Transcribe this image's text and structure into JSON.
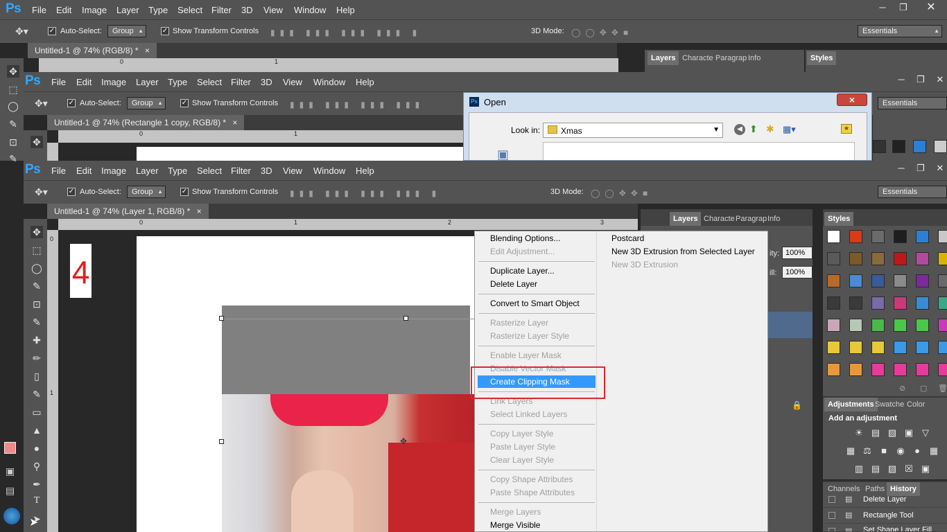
{
  "app": {
    "logo": "Ps",
    "menu": [
      "File",
      "Edit",
      "Image",
      "Layer",
      "Type",
      "Select",
      "Filter",
      "3D",
      "View",
      "Window",
      "Help"
    ],
    "window_buttons": [
      "minimize-icon",
      "restore-icon",
      "close-icon"
    ]
  },
  "options": {
    "auto_select_label": "Auto-Select:",
    "auto_select_value": "Group",
    "show_transform_label": "Show Transform Controls",
    "mode_3d_label": "3D Mode:",
    "workspace": "Essentials"
  },
  "windows": {
    "top": {
      "tab": "Untitled-1 @ 74% (RGB/8) *",
      "tab_close": "×"
    },
    "middle": {
      "tab": "Untitled-1 @ 74% (Rectangle 1 copy, RGB/8) *",
      "tab_close": "×"
    },
    "front": {
      "tab": "Untitled-1 @ 74% (Layer 1, RGB/8) *",
      "tab_close": "×"
    }
  },
  "rulers": {
    "top_marks": [
      "0",
      "1"
    ],
    "middle_marks": [
      "0",
      "1"
    ],
    "front_marks": [
      "0",
      "1",
      "2",
      "3"
    ],
    "left_marks": [
      "0",
      "1"
    ]
  },
  "top_panel_tabs": [
    "Layers",
    "Characte",
    "Paragrap",
    "Info"
  ],
  "top_styles_tab": "Styles",
  "open_dialog": {
    "title": "Open",
    "look_in_label": "Look in:",
    "folder": "Xmas",
    "close": "×"
  },
  "canvas": {
    "step_number": "4"
  },
  "context_menu": {
    "left": [
      {
        "label": "Blending Options...",
        "disabled": false
      },
      {
        "label": "Edit Adjustment...",
        "disabled": true
      },
      {
        "label": "Duplicate Layer...",
        "disabled": false
      },
      {
        "label": "Delete Layer",
        "disabled": false
      },
      {
        "label": "Convert to Smart Object",
        "disabled": false
      },
      {
        "label": "Rasterize Layer",
        "disabled": true
      },
      {
        "label": "Rasterize Layer Style",
        "disabled": true
      },
      {
        "label": "Enable Layer Mask",
        "disabled": true
      },
      {
        "label": "Disable Vector Mask",
        "disabled": true
      },
      {
        "label": "Create Clipping Mask",
        "disabled": false,
        "highlighted": true
      },
      {
        "label": "Link Layers",
        "disabled": true
      },
      {
        "label": "Select Linked Layers",
        "disabled": true
      },
      {
        "label": "Copy Layer Style",
        "disabled": true
      },
      {
        "label": "Paste Layer Style",
        "disabled": true
      },
      {
        "label": "Clear Layer Style",
        "disabled": true
      },
      {
        "label": "Copy Shape Attributes",
        "disabled": true
      },
      {
        "label": "Paste Shape Attributes",
        "disabled": true
      },
      {
        "label": "Merge Layers",
        "disabled": true
      },
      {
        "label": "Merge Visible",
        "disabled": false
      }
    ],
    "right": [
      {
        "label": "Postcard",
        "disabled": false
      },
      {
        "label": "New 3D Extrusion from Selected Layer",
        "disabled": false
      },
      {
        "label": "New 3D Extrusion",
        "disabled": true
      }
    ]
  },
  "layers_panel": {
    "tabs": [
      "Layers",
      "Characte",
      "Paragrap",
      "Info"
    ],
    "opacity_label": "ity:",
    "opacity": "100%",
    "fill_label": "ill:",
    "fill": "100%"
  },
  "styles_panel": {
    "tab": "Styles",
    "swatch_colors": [
      "#ffffff",
      "#d83a1a",
      "#6b6b6b",
      "#1e1e1e",
      "#2d7fd4",
      "#c8c8c8",
      "#5a5a5a",
      "#7a5a2a",
      "#8a6a3a",
      "#c01818",
      "#b04a9a",
      "#d8b400",
      "#b86a2a",
      "#4a8ad8",
      "#3a5a9a",
      "#8a8a8a",
      "#7a2a9a",
      "#6a6a6a",
      "#3a3a3a",
      "#3a3a3a",
      "#7a6aa8",
      "#c83a7a",
      "#3a8ad8",
      "#3aa888",
      "#c8a8b8",
      "#b8c8b8",
      "#4ab84a",
      "#4ac84a",
      "#4ac84a",
      "#c83ab8",
      "#e8c83a",
      "#e8c83a",
      "#e8c83a",
      "#3a9ae8",
      "#3a9ae8",
      "#3a9ae8",
      "#e8983a",
      "#e8983a",
      "#e83a9a",
      "#e83a9a",
      "#e83a9a",
      "#e83a9a"
    ]
  },
  "adjustments_panel": {
    "tabs": [
      "Adjustments",
      "Swatche",
      "Color"
    ],
    "heading": "Add an adjustment"
  },
  "history_panel": {
    "tabs": [
      "Channels",
      "Paths",
      "History"
    ],
    "items": [
      "Delete Layer",
      "Rectangle Tool",
      "Set Shape Layer Fill"
    ]
  }
}
